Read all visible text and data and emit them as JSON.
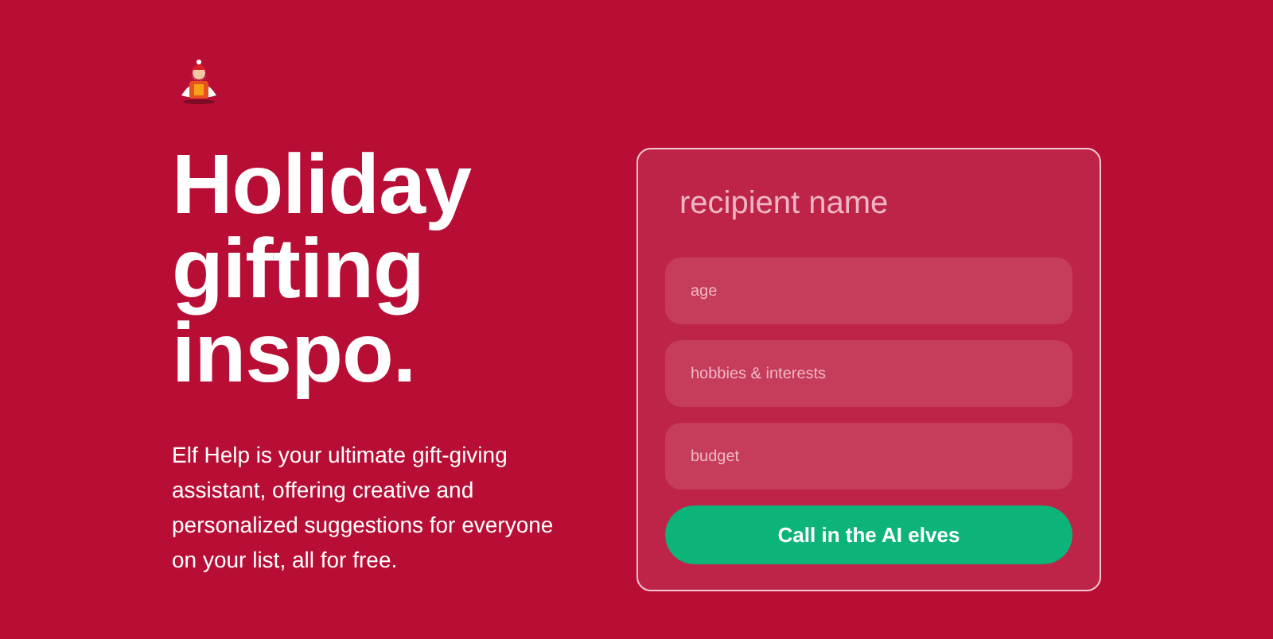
{
  "hero": {
    "heading": "Holiday gifting inspo.",
    "description": "Elf Help is your ultimate gift-giving assistant, offering creative and personalized suggestions for everyone on your list, all for free."
  },
  "form": {
    "name_field": {
      "placeholder": "recipient name"
    },
    "fields": [
      {
        "placeholder": "age"
      },
      {
        "placeholder": "hobbies & interests"
      },
      {
        "placeholder": "budget"
      }
    ],
    "button": "Call in the AI elves"
  }
}
